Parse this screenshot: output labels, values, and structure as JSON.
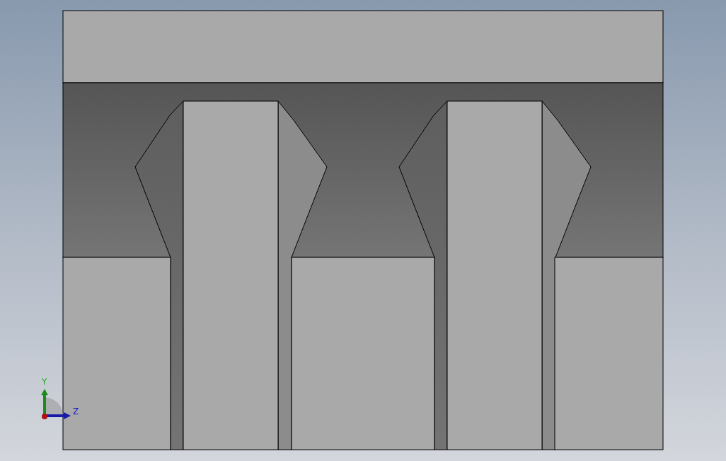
{
  "viewport": {
    "triad": {
      "axis_labels": [
        {
          "kind": "y",
          "text": "Y"
        },
        {
          "kind": "z",
          "text": "Z"
        }
      ]
    }
  }
}
